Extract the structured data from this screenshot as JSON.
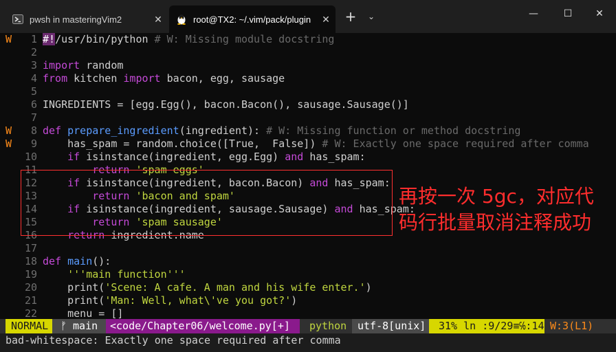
{
  "tabs": [
    {
      "title": "pwsh in masteringVim2",
      "close": "✕"
    },
    {
      "title": "root@TX2: ~/.vim/pack/plugin",
      "close": "✕"
    }
  ],
  "window_controls": {
    "new_tab": "+",
    "dropdown": "⌄",
    "minimize": "—",
    "maximize": "☐",
    "close": "✕"
  },
  "editor": {
    "lines": [
      {
        "num": "1",
        "sign": "W",
        "code": "#!/usr/bin/python # W: Missing module docstring"
      },
      {
        "num": "2",
        "sign": "",
        "code": ""
      },
      {
        "num": "3",
        "sign": "",
        "code": "import random"
      },
      {
        "num": "4",
        "sign": "",
        "code": "from kitchen import bacon, egg, sausage"
      },
      {
        "num": "5",
        "sign": "",
        "code": ""
      },
      {
        "num": "6",
        "sign": "",
        "code": "INGREDIENTS = [egg.Egg(), bacon.Bacon(), sausage.Sausage()]"
      },
      {
        "num": "7",
        "sign": "",
        "code": ""
      },
      {
        "num": "8",
        "sign": "W",
        "code": "def prepare_ingredient(ingredient): # W: Missing function or method docstring"
      },
      {
        "num": "9",
        "sign": "W",
        "code": "    has_spam = random.choice([True,  False]) # W: Exactly one space required after comma"
      },
      {
        "num": "10",
        "sign": "",
        "code": "    if isinstance(ingredient, egg.Egg) and has_spam:"
      },
      {
        "num": "11",
        "sign": "",
        "code": "        return 'spam eggs'"
      },
      {
        "num": "12",
        "sign": "",
        "code": "    if isinstance(ingredient, bacon.Bacon) and has_spam:"
      },
      {
        "num": "13",
        "sign": "",
        "code": "        return 'bacon and spam'"
      },
      {
        "num": "14",
        "sign": "",
        "code": "    if isinstance(ingredient, sausage.Sausage) and has_spam:"
      },
      {
        "num": "15",
        "sign": "",
        "code": "        return 'spam sausage'"
      },
      {
        "num": "16",
        "sign": "",
        "code": "    return ingredient.name"
      },
      {
        "num": "17",
        "sign": "",
        "code": ""
      },
      {
        "num": "18",
        "sign": "",
        "code": "def main():"
      },
      {
        "num": "19",
        "sign": "",
        "code": "    '''main function'''"
      },
      {
        "num": "20",
        "sign": "",
        "code": "    print('Scene: A cafe. A man and his wife enter.')"
      },
      {
        "num": "21",
        "sign": "",
        "code": "    print('Man: Well, what\\'ve you got?')"
      },
      {
        "num": "22",
        "sign": "",
        "code": "    menu = []"
      }
    ]
  },
  "annotation": "再按一次 5gc，对应代码行批量取消注释成功",
  "statusline": {
    "mode": "NORMAL",
    "branch": "ᚠ main",
    "file": "<code/Chapter06/welcome.py[+]",
    "filetype": "python",
    "encoding": "utf-8[unix]",
    "percent": "31%",
    "position": "ln :9/29≡℅:14",
    "warnings": "W:3(L1)"
  },
  "cmdline": "bad-whitespace: Exactly one space required after comma",
  "colors": {
    "mode_bg": "#d7d700",
    "file_bg": "#8a1a8c",
    "filetype_fg": "#c0d63f",
    "warn_fg": "#ff8c1a",
    "annotation": "#ff2d2d"
  }
}
